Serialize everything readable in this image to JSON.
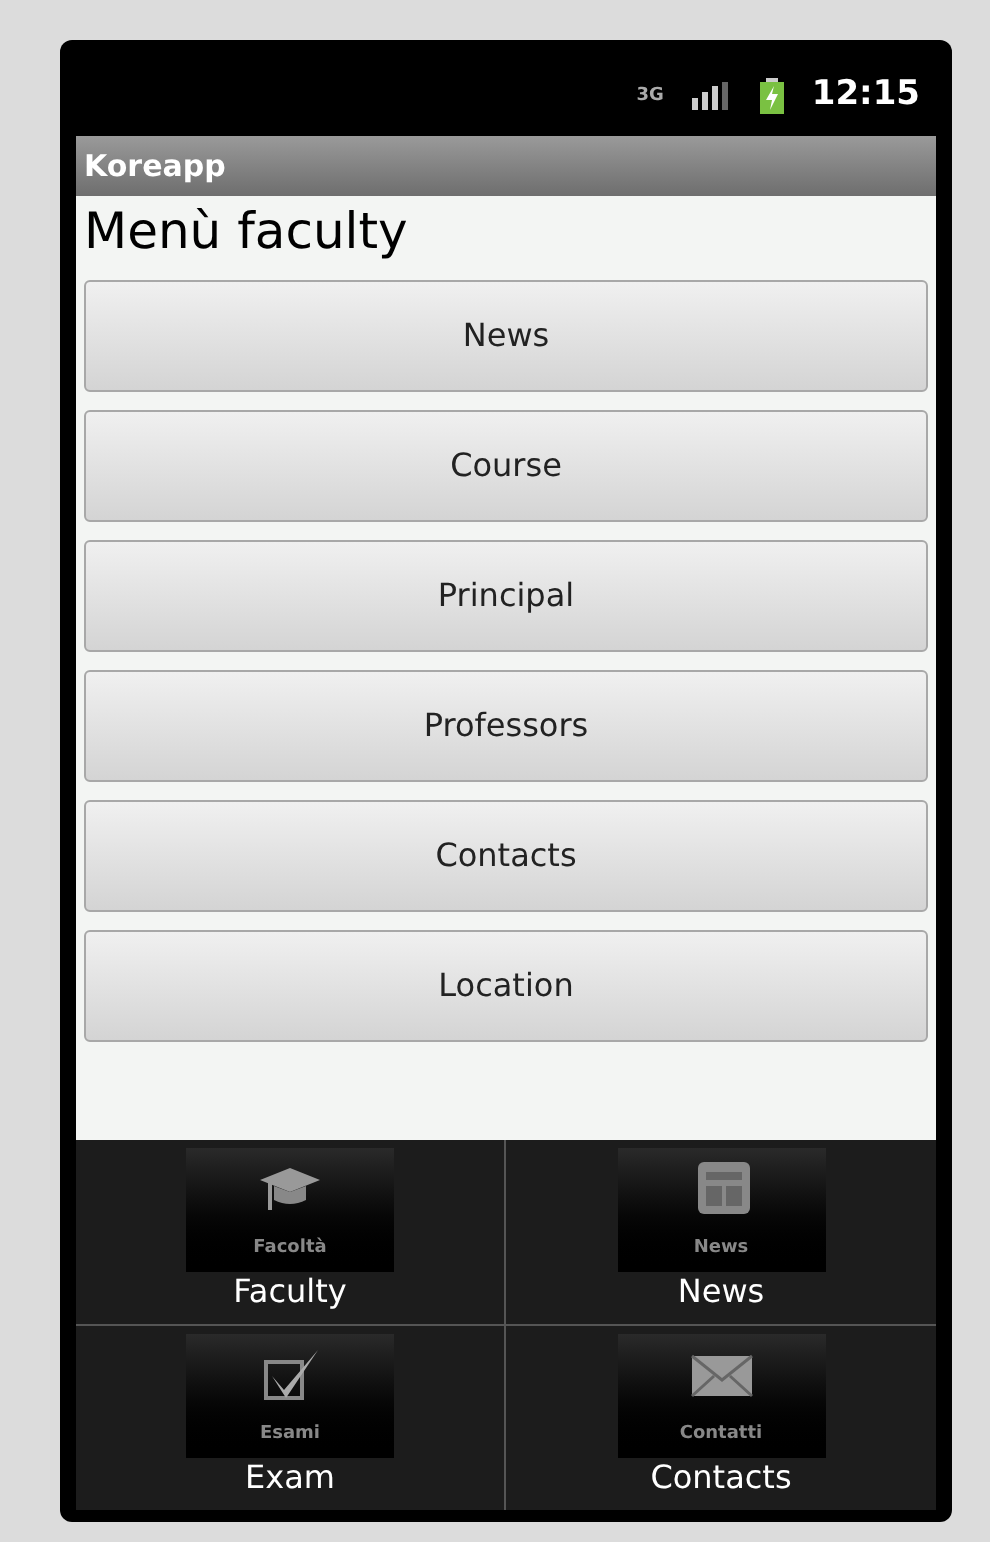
{
  "status_bar": {
    "time": "12:15",
    "network": "3G"
  },
  "app_bar": {
    "title": "Koreapp"
  },
  "heading": "Menù faculty",
  "buttons": [
    "News",
    "Course",
    "Principal",
    "Professors",
    "Contacts",
    "Location"
  ],
  "options_menu": [
    {
      "kind": "cap",
      "caption": "Facoltà",
      "label": "Faculty"
    },
    {
      "kind": "paper",
      "caption": "News",
      "label": "News"
    },
    {
      "kind": "check",
      "caption": "Esami",
      "label": "Exam"
    },
    {
      "kind": "mail",
      "caption": "Contatti",
      "label": "Contacts"
    }
  ]
}
